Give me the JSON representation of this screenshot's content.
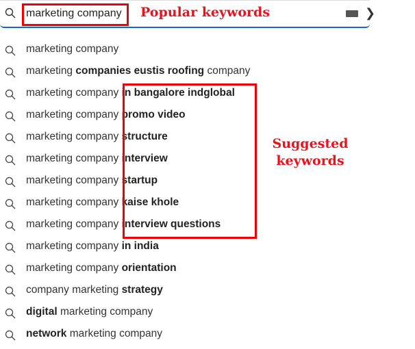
{
  "search": {
    "value": "marketing company"
  },
  "annotations": {
    "popular": "Popular keywords",
    "suggested_line1": "Suggested",
    "suggested_line2": "keywords",
    "color": "#e8131f"
  },
  "suggestions": [
    [
      {
        "t": "marketing company",
        "b": false
      }
    ],
    [
      {
        "t": "marketing ",
        "b": false
      },
      {
        "t": "companies eustis roofing",
        "b": true
      },
      {
        "t": " company",
        "b": false
      }
    ],
    [
      {
        "t": "marketing company ",
        "b": false
      },
      {
        "t": "in bangalore indglobal",
        "b": true
      }
    ],
    [
      {
        "t": "marketing company ",
        "b": false
      },
      {
        "t": "promo video",
        "b": true
      }
    ],
    [
      {
        "t": "marketing company ",
        "b": false
      },
      {
        "t": "structure",
        "b": true
      }
    ],
    [
      {
        "t": "marketing company ",
        "b": false
      },
      {
        "t": "interview",
        "b": true
      }
    ],
    [
      {
        "t": "marketing company ",
        "b": false
      },
      {
        "t": "startup",
        "b": true
      }
    ],
    [
      {
        "t": "marketing company ",
        "b": false
      },
      {
        "t": "kaise khole",
        "b": true
      }
    ],
    [
      {
        "t": "marketing company ",
        "b": false
      },
      {
        "t": "interview questions",
        "b": true
      }
    ],
    [
      {
        "t": "marketing company ",
        "b": false
      },
      {
        "t": "in india",
        "b": true
      }
    ],
    [
      {
        "t": "marketing company ",
        "b": false
      },
      {
        "t": "orientation",
        "b": true
      }
    ],
    [
      {
        "t": "company marketing ",
        "b": false
      },
      {
        "t": "strategy",
        "b": true
      }
    ],
    [
      {
        "t": "digital",
        "b": true
      },
      {
        "t": " marketing company",
        "b": false
      }
    ],
    [
      {
        "t": "network",
        "b": true
      },
      {
        "t": " marketing company",
        "b": false
      }
    ]
  ]
}
